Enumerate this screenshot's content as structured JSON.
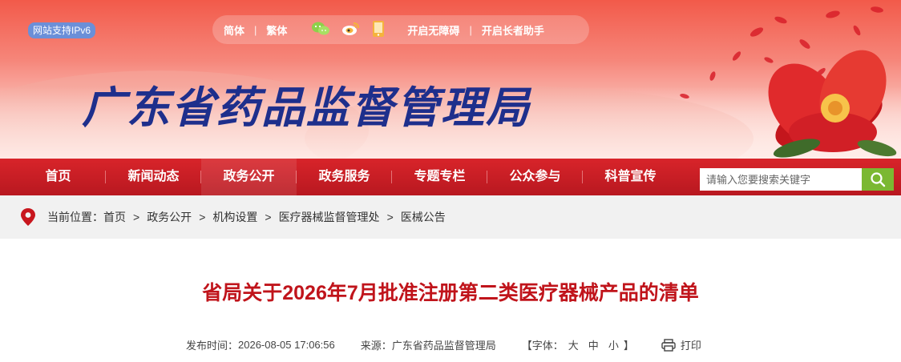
{
  "header": {
    "ipv6_badge": "网站支持IPv6",
    "toolbar": {
      "simplified": "简体",
      "traditional": "繁体",
      "accessibility": "开启无障碍",
      "elder_mode": "开启长者助手",
      "icons": [
        "wechat-icon",
        "weibo-icon",
        "mobile-icon"
      ]
    },
    "site_title": "广东省药品监督管理局"
  },
  "nav": {
    "items": [
      "首页",
      "新闻动态",
      "政务公开",
      "政务服务",
      "专题专栏",
      "公众参与",
      "科普宣传"
    ],
    "active_index": 2
  },
  "search": {
    "placeholder": "请输入您要搜索关键字"
  },
  "breadcrumb": {
    "label": "当前位置：",
    "items": [
      "首页",
      "政务公开",
      "机构设置",
      "医疗器械监督管理处",
      "医械公告"
    ],
    "separator": ">"
  },
  "article": {
    "title": "省局关于2026年7月批准注册第二类医疗器械产品的清单",
    "publish_label": "发布时间：",
    "publish_time": "2026-08-05 17:06:56",
    "source_label": "来源：",
    "source": "广东省药品监督管理局",
    "font_label": "【字体：",
    "font_large": "大",
    "font_medium": "中",
    "font_small": "小",
    "font_close": "】",
    "print": "打印"
  },
  "colors": {
    "nav_red": "#c81d23",
    "title_red": "#c0141b",
    "site_title_blue": "#1e2f8c",
    "search_green": "#7bb832"
  }
}
